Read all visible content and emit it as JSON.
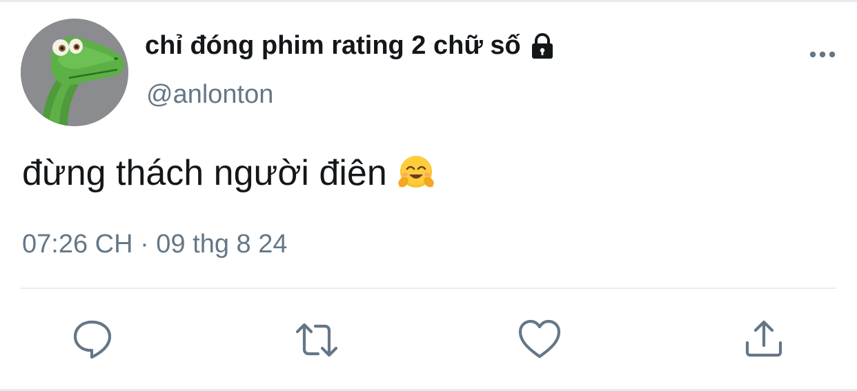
{
  "tweet": {
    "display_name": "chỉ đóng phim rating 2 chữ số",
    "handle": "@anlonton",
    "text": "đừng thách người điên",
    "emoji": "hugging-face-emoji",
    "timestamp": "07:26 CH · 09 thg 8 24",
    "protected": true
  },
  "icons": {
    "lock": "lock-icon",
    "more": "more-icon",
    "reply": "reply-icon",
    "retweet": "retweet-icon",
    "like": "like-icon",
    "share": "share-icon"
  },
  "colors": {
    "text_primary": "#14171a",
    "text_secondary": "#657786",
    "divider": "#e6ecf0",
    "icon": "#657786"
  }
}
